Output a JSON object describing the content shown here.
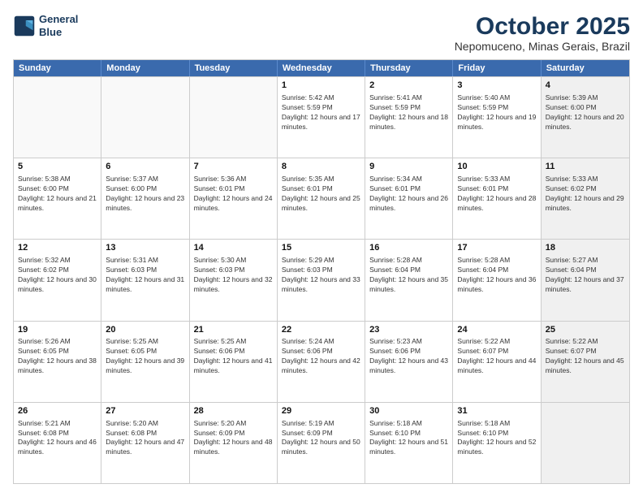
{
  "header": {
    "logo_line1": "General",
    "logo_line2": "Blue",
    "title": "October 2025",
    "subtitle": "Nepomuceno, Minas Gerais, Brazil"
  },
  "days_of_week": [
    "Sunday",
    "Monday",
    "Tuesday",
    "Wednesday",
    "Thursday",
    "Friday",
    "Saturday"
  ],
  "weeks": [
    [
      {
        "day": "",
        "empty": true
      },
      {
        "day": "",
        "empty": true
      },
      {
        "day": "",
        "empty": true
      },
      {
        "day": "1",
        "sunrise": "5:42 AM",
        "sunset": "5:59 PM",
        "daylight": "12 hours and 17 minutes."
      },
      {
        "day": "2",
        "sunrise": "5:41 AM",
        "sunset": "5:59 PM",
        "daylight": "12 hours and 18 minutes."
      },
      {
        "day": "3",
        "sunrise": "5:40 AM",
        "sunset": "5:59 PM",
        "daylight": "12 hours and 19 minutes."
      },
      {
        "day": "4",
        "sunrise": "5:39 AM",
        "sunset": "6:00 PM",
        "daylight": "12 hours and 20 minutes.",
        "shaded": true
      }
    ],
    [
      {
        "day": "5",
        "sunrise": "5:38 AM",
        "sunset": "6:00 PM",
        "daylight": "12 hours and 21 minutes."
      },
      {
        "day": "6",
        "sunrise": "5:37 AM",
        "sunset": "6:00 PM",
        "daylight": "12 hours and 23 minutes."
      },
      {
        "day": "7",
        "sunrise": "5:36 AM",
        "sunset": "6:01 PM",
        "daylight": "12 hours and 24 minutes."
      },
      {
        "day": "8",
        "sunrise": "5:35 AM",
        "sunset": "6:01 PM",
        "daylight": "12 hours and 25 minutes."
      },
      {
        "day": "9",
        "sunrise": "5:34 AM",
        "sunset": "6:01 PM",
        "daylight": "12 hours and 26 minutes."
      },
      {
        "day": "10",
        "sunrise": "5:33 AM",
        "sunset": "6:01 PM",
        "daylight": "12 hours and 28 minutes."
      },
      {
        "day": "11",
        "sunrise": "5:33 AM",
        "sunset": "6:02 PM",
        "daylight": "12 hours and 29 minutes.",
        "shaded": true
      }
    ],
    [
      {
        "day": "12",
        "sunrise": "5:32 AM",
        "sunset": "6:02 PM",
        "daylight": "12 hours and 30 minutes."
      },
      {
        "day": "13",
        "sunrise": "5:31 AM",
        "sunset": "6:03 PM",
        "daylight": "12 hours and 31 minutes."
      },
      {
        "day": "14",
        "sunrise": "5:30 AM",
        "sunset": "6:03 PM",
        "daylight": "12 hours and 32 minutes."
      },
      {
        "day": "15",
        "sunrise": "5:29 AM",
        "sunset": "6:03 PM",
        "daylight": "12 hours and 33 minutes."
      },
      {
        "day": "16",
        "sunrise": "5:28 AM",
        "sunset": "6:04 PM",
        "daylight": "12 hours and 35 minutes."
      },
      {
        "day": "17",
        "sunrise": "5:28 AM",
        "sunset": "6:04 PM",
        "daylight": "12 hours and 36 minutes."
      },
      {
        "day": "18",
        "sunrise": "5:27 AM",
        "sunset": "6:04 PM",
        "daylight": "12 hours and 37 minutes.",
        "shaded": true
      }
    ],
    [
      {
        "day": "19",
        "sunrise": "5:26 AM",
        "sunset": "6:05 PM",
        "daylight": "12 hours and 38 minutes."
      },
      {
        "day": "20",
        "sunrise": "5:25 AM",
        "sunset": "6:05 PM",
        "daylight": "12 hours and 39 minutes."
      },
      {
        "day": "21",
        "sunrise": "5:25 AM",
        "sunset": "6:06 PM",
        "daylight": "12 hours and 41 minutes."
      },
      {
        "day": "22",
        "sunrise": "5:24 AM",
        "sunset": "6:06 PM",
        "daylight": "12 hours and 42 minutes."
      },
      {
        "day": "23",
        "sunrise": "5:23 AM",
        "sunset": "6:06 PM",
        "daylight": "12 hours and 43 minutes."
      },
      {
        "day": "24",
        "sunrise": "5:22 AM",
        "sunset": "6:07 PM",
        "daylight": "12 hours and 44 minutes."
      },
      {
        "day": "25",
        "sunrise": "5:22 AM",
        "sunset": "6:07 PM",
        "daylight": "12 hours and 45 minutes.",
        "shaded": true
      }
    ],
    [
      {
        "day": "26",
        "sunrise": "5:21 AM",
        "sunset": "6:08 PM",
        "daylight": "12 hours and 46 minutes."
      },
      {
        "day": "27",
        "sunrise": "5:20 AM",
        "sunset": "6:08 PM",
        "daylight": "12 hours and 47 minutes."
      },
      {
        "day": "28",
        "sunrise": "5:20 AM",
        "sunset": "6:09 PM",
        "daylight": "12 hours and 48 minutes."
      },
      {
        "day": "29",
        "sunrise": "5:19 AM",
        "sunset": "6:09 PM",
        "daylight": "12 hours and 50 minutes."
      },
      {
        "day": "30",
        "sunrise": "5:18 AM",
        "sunset": "6:10 PM",
        "daylight": "12 hours and 51 minutes."
      },
      {
        "day": "31",
        "sunrise": "5:18 AM",
        "sunset": "6:10 PM",
        "daylight": "12 hours and 52 minutes."
      },
      {
        "day": "",
        "empty": true,
        "shaded": true
      }
    ]
  ]
}
